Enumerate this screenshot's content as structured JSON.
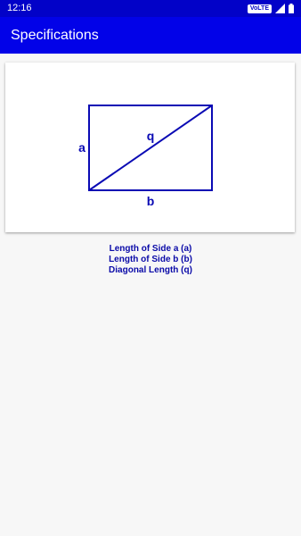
{
  "status_bar": {
    "time": "12:16",
    "network_badge": "VoLTE",
    "icons": [
      "volte-icon",
      "signal-icon",
      "battery-icon"
    ]
  },
  "app_bar": {
    "title": "Specifications"
  },
  "diagram": {
    "labels": {
      "side_a": "a",
      "side_b": "b",
      "diagonal": "q"
    },
    "stroke_color": "#0a0ab4"
  },
  "specs": {
    "items": [
      "Length of Side a (a)",
      "Length of Side b (b)",
      "Diagonal Length (q)"
    ]
  },
  "colors": {
    "status_bar": "#0202c8",
    "app_bar": "#0202e8",
    "accent": "#0a0ab4",
    "background": "#f7f7f7"
  }
}
